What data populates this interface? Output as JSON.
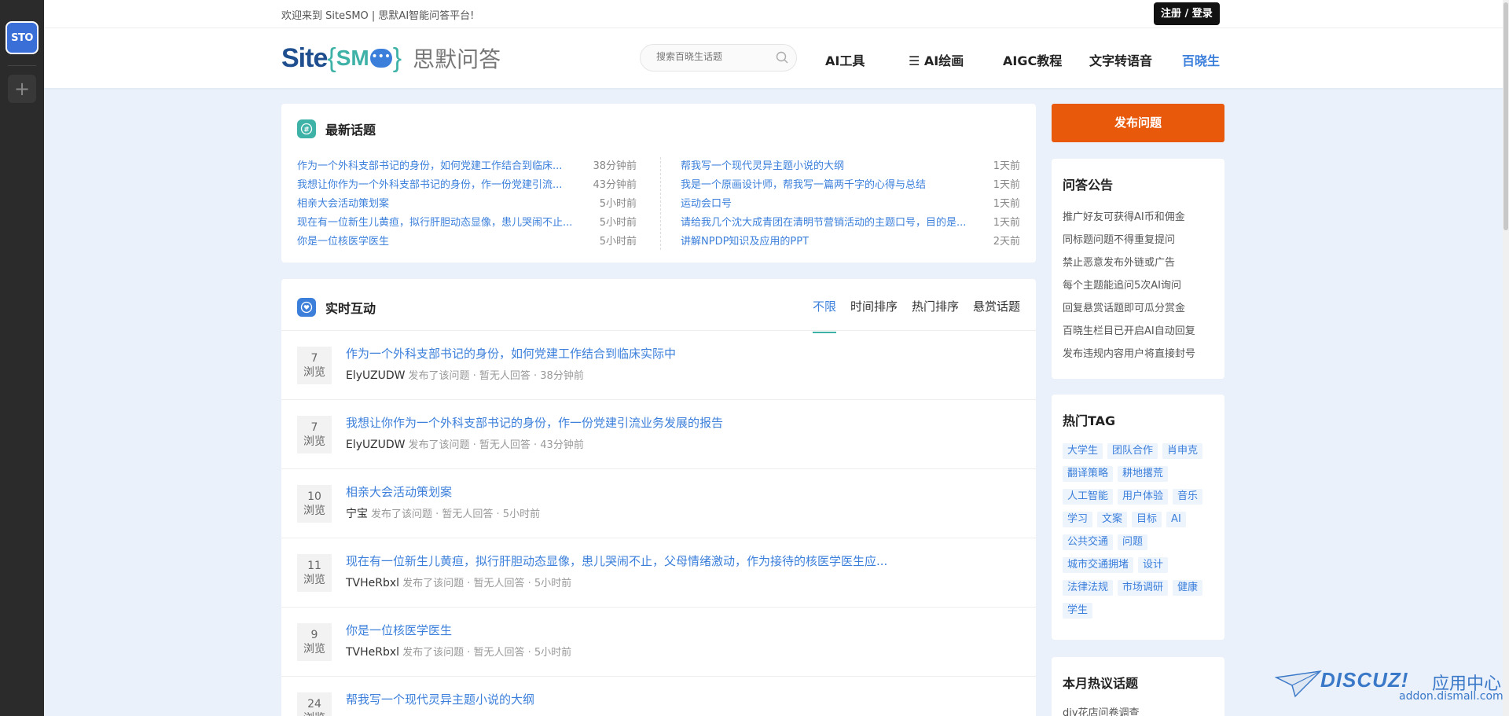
{
  "dock": {
    "app_label": "STO",
    "add_label": "+"
  },
  "topbar": {
    "welcome": "欢迎来到 SiteSMO | 思默AI智能问答平台!",
    "login": "注册 / 登录"
  },
  "logo": {
    "site": "Site",
    "brace_open": "{",
    "sm": "SM",
    "dots": "•••",
    "brace_close": "}",
    "cn": "思默问答"
  },
  "search": {
    "placeholder": "搜索百晓生话题"
  },
  "nav": {
    "items": [
      {
        "label": "AI工具"
      },
      {
        "label": "☰ AI绘画"
      },
      {
        "label": "AIGC教程"
      },
      {
        "label": "文字转语音"
      },
      {
        "label": "百晓生"
      }
    ]
  },
  "latest": {
    "title": "最新话题",
    "left": [
      {
        "title": "作为一个外科支部书记的身份，如何党建工作结合到临床...",
        "time": "38分钟前"
      },
      {
        "title": "我想让你作为一个外科支部书记的身份，作一份党建引流...",
        "time": "43分钟前"
      },
      {
        "title": "相亲大会活动策划案",
        "time": "5小时前"
      },
      {
        "title": "现在有一位新生儿黄疸，拟行肝胆动态显像，患儿哭闹不止...",
        "time": "5小时前"
      },
      {
        "title": "你是一位核医学医生",
        "time": "5小时前"
      }
    ],
    "right": [
      {
        "title": "帮我写一个现代灵异主题小说的大纲",
        "time": "1天前"
      },
      {
        "title": "我是一个原画设计师，帮我写一篇两千字的心得与总结",
        "time": "1天前"
      },
      {
        "title": "运动会口号",
        "time": "1天前"
      },
      {
        "title": "请给我几个沈大成青团在清明节营销活动的主题口号，目的是...",
        "time": "1天前"
      },
      {
        "title": "讲解NPDP知识及应用的PPT",
        "time": "2天前"
      }
    ]
  },
  "live": {
    "title": "实时互动",
    "tabs": [
      "不限",
      "时间排序",
      "热门排序",
      "悬赏话题"
    ],
    "views_label": "浏览",
    "items": [
      {
        "views": "7",
        "title": "作为一个外科支部书记的身份，如何党建工作结合到临床实际中",
        "user": "ElyUZUDW",
        "meta": "发布了该问题 · 暂无人回答 · 38分钟前"
      },
      {
        "views": "7",
        "title": "我想让你作为一个外科支部书记的身份，作一份党建引流业务发展的报告",
        "user": "ElyUZUDW",
        "meta": "发布了该问题 · 暂无人回答 · 43分钟前"
      },
      {
        "views": "10",
        "title": "相亲大会活动策划案",
        "user": "宁宝",
        "meta": "发布了该问题 · 暂无人回答 · 5小时前"
      },
      {
        "views": "11",
        "title": "现在有一位新生儿黄疸，拟行肝胆动态显像，患儿哭闹不止，父母情绪激动，作为接待的核医学医生应...",
        "user": "TVHeRbxl",
        "meta": "发布了该问题 · 暂无人回答 · 5小时前"
      },
      {
        "views": "9",
        "title": "你是一位核医学医生",
        "user": "TVHeRbxl",
        "meta": "发布了该问题 · 暂无人回答 · 5小时前"
      },
      {
        "views": "24",
        "title": "帮我写一个现代灵异主题小说的大纲",
        "user": "",
        "meta": ""
      }
    ]
  },
  "sidebar": {
    "publish": "发布问题",
    "notice_title": "问答公告",
    "notices": [
      "推广好友可获得AI币和佣金",
      "同标题问题不得重复提问",
      "禁止恶意发布外链或广告",
      "每个主题能追问5次AI询问",
      "回复悬赏话题即可瓜分赏金",
      "百晓生栏目已开启AI自动回复",
      "发布违规内容用户将直接封号"
    ],
    "hottag_title": "热门TAG",
    "tags": [
      "大学生",
      "团队合作",
      "肖申克",
      "翻译策略",
      "耕地撂荒",
      "人工智能",
      "用户体验",
      "音乐",
      "学习",
      "文案",
      "目标",
      "AI",
      "公共交通",
      "问题",
      "城市交通拥堵",
      "设计",
      "法律法规",
      "市场调研",
      "健康",
      "学生"
    ],
    "monthly_title": "本月热议话题",
    "monthly_first": "diy花店问卷调查"
  },
  "watermark": {
    "logo": "DISCUZ!",
    "cn": "应用中心",
    "url": "addon.dismall.com"
  },
  "colors": {
    "accent": "#3b7fdb",
    "teal": "#3fb2a8",
    "publish": "#e8590c",
    "background": "#eaf1fb"
  }
}
